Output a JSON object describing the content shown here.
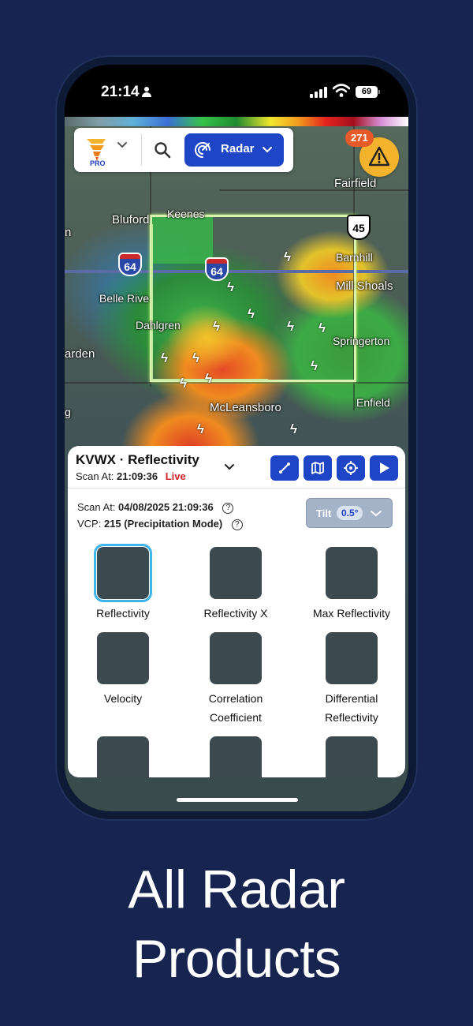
{
  "status_bar": {
    "time": "21:14",
    "battery": "69"
  },
  "map": {
    "towns": {
      "fairfield": "Fairfield",
      "bluford": "Bluford",
      "keenes": "Keenes",
      "barnhill": "Barnhill",
      "mill_shoals": "Mill Shoals",
      "belle_rive": "Belle Rive",
      "dahlgren": "Dahlgren",
      "springerton": "Springerton",
      "arden": "arden",
      "mcleansboro": "McLeansboro",
      "enfield": "Enfield",
      "n_fragment": "n",
      "g_fragment": "g"
    },
    "shields": {
      "i64_left": "64",
      "i64_center": "64",
      "us45": "45"
    }
  },
  "top_bar": {
    "logo_tag": "PRO",
    "radar_label": "Radar"
  },
  "alerts": {
    "count": "271"
  },
  "panel": {
    "title": "KVWX · Reflectivity",
    "scan_prefix": "Scan At:",
    "scan_time": "21:09:36",
    "live_label": "Live",
    "scan_at_label": "Scan At:",
    "scan_at_value": "04/08/2025 21:09:36",
    "vcp_label": "VCP:",
    "vcp_value": "215 (Precipitation Mode)",
    "tilt_label": "Tilt",
    "tilt_value": "0.5°",
    "products": [
      {
        "label": "Reflectivity",
        "selected": true
      },
      {
        "label": "Reflectivity X"
      },
      {
        "label": "Max Reflectivity"
      },
      {
        "label": "Velocity"
      },
      {
        "label": "Correlation Coefficient"
      },
      {
        "label": "Differential Reflectivity"
      }
    ]
  },
  "headline": {
    "line1": "All Radar",
    "line2": "Products"
  },
  "colors": {
    "background": "#17244f",
    "accent": "#1f45c7",
    "live": "#d0212a",
    "alert": "#f3b32d"
  }
}
